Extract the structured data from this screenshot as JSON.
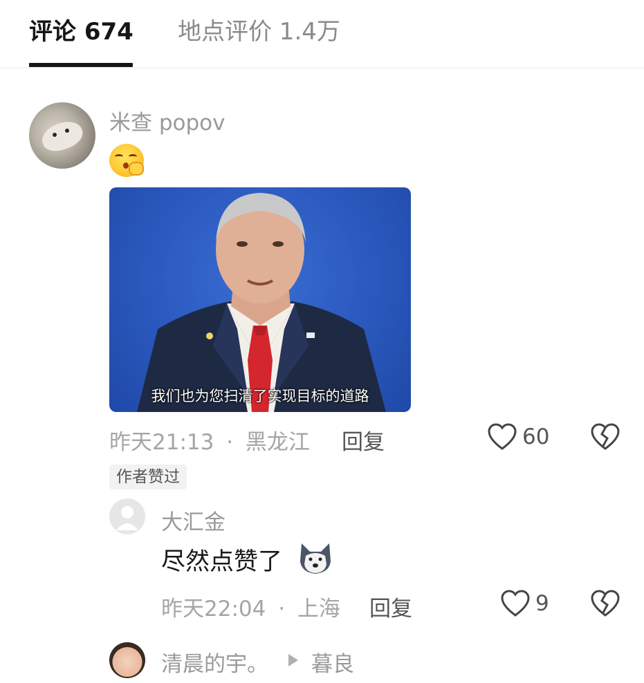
{
  "tabs": [
    {
      "label": "评论 674",
      "active": true
    },
    {
      "label": "地点评价 1.4万",
      "active": false
    }
  ],
  "comment": {
    "username": "米查 popov",
    "emoji": "kiss-blowing-emoji",
    "video": {
      "subtitle": "我们也为您扫清了实现目标的道路"
    },
    "time": "昨天21:13",
    "location": "黑龙江",
    "separator": "·",
    "reply_label": "回复",
    "likes": "60",
    "badge": "作者赞过"
  },
  "reply": {
    "username": "大汇金",
    "text": "尽然点赞了",
    "emoji": "husky-emoji",
    "time": "昨天22:04",
    "location": "上海",
    "separator": "·",
    "reply_label": "回复",
    "likes": "9"
  },
  "next_reply": {
    "username": "清晨的宇。",
    "reply_to": "暮良"
  },
  "colors": {
    "active_tab": "#161616",
    "inactive_tab": "#8a8a8a",
    "meta": "#a5a5a5",
    "video_bg": "#2d5cc2"
  }
}
